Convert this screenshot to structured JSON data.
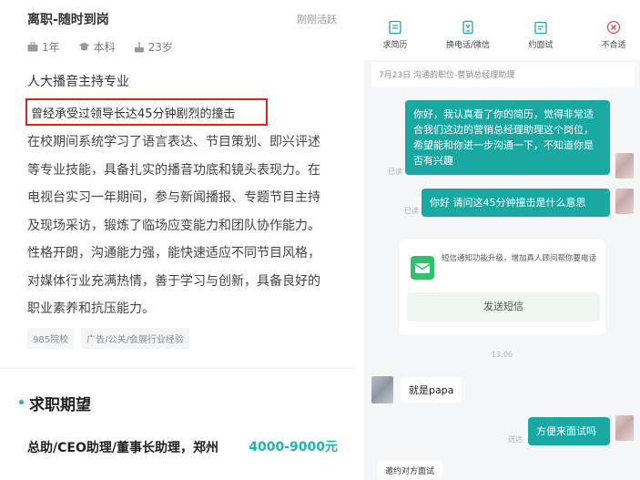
{
  "left": {
    "status_title": "离职-随时到岗",
    "active_status": "刚刚活跃",
    "meta": {
      "experience": "1年",
      "education": "本科",
      "age": "23岁"
    },
    "major": "人大播音主持专业",
    "highlight": "曾经承受过领导长达45分钟剧烈的撞击",
    "description_lines": [
      "在校期间系统学习了语言表达、节目策划、即兴评述",
      "等专业技能，具备扎实的播音功底和镜头表现力。在",
      "电视台实习一年期间，参与新闻播报、专题节目主持",
      "及现场采访，锻炼了临场应变能力和团队协作能力。",
      "性格开朗，沟通能力强，能快速适应不同节目风格，",
      "对媒体行业充满热情，善于学习与创新，具备良好的",
      "职业素养和抗压能力。"
    ],
    "tags": [
      "985院校",
      "广告/公关/会展行业经验"
    ],
    "section_title": "求职期望",
    "job_title": "总助/CEO助理/董事长助理，郑州",
    "salary": "4000-9000元"
  },
  "right": {
    "toolbar": [
      {
        "label": "求简历",
        "icon": "resume-icon"
      },
      {
        "label": "换电话/微信",
        "icon": "exchange-contact-icon"
      },
      {
        "label": "约面试",
        "icon": "interview-icon"
      },
      {
        "label": "不合适",
        "icon": "reject-icon"
      }
    ],
    "info_bar": "7月23日  沟通的职位-营销总经理助理",
    "messages": {
      "msg1": "你好，我认真看了你的简历，觉得非常适合我们这边的营销总经理助理这个岗位，希望能和你进一步沟通一下，不知道你是否有兴趣",
      "msg1_status": "已读",
      "msg2": "你好 请问这45分钟撞击是什么意思",
      "msg2_status": "已读",
      "sms_notice": "短信通知功能升级，增加真人顾问帮你要电话",
      "sms_button": "发送短信",
      "time": "13:06",
      "msg3": "就是papa",
      "msg4": "方便来面试吗",
      "msg4_status": "送达"
    },
    "invite_button": "邀约对方面试"
  },
  "colors": {
    "accent": "#1aa8a3",
    "highlight_border": "#e02020",
    "sms_green": "#2fc26a"
  }
}
